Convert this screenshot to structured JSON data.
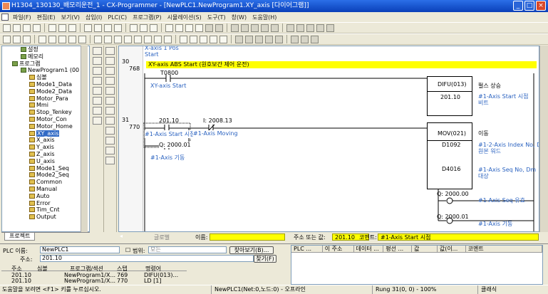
{
  "window": {
    "title": "H1304_130130_배모리운전_1 - CX-Programmer - [NewPLC1.NewProgram1.XY_axis  [다이어그램]]",
    "minimize": "_",
    "maximize": "□",
    "close": "×"
  },
  "menu": [
    "파일(F)",
    "편집(E)",
    "보기(V)",
    "삽입(I)",
    "PLC(C)",
    "프로그램(P)",
    "시뮬레이션(S)",
    "도구(T)",
    "창(W)",
    "도움말(H)"
  ],
  "tree": {
    "items": [
      {
        "label": "설정",
        "level": 1,
        "icon": "settings-icon"
      },
      {
        "label": "메모리",
        "level": 1,
        "icon": "memory-icon"
      },
      {
        "label": "프로그램",
        "level": 0,
        "icon": "programs-icon"
      },
      {
        "label": "NewProgram1 (00",
        "level": 1,
        "icon": "program-icon"
      },
      {
        "label": "심볼",
        "level": 2,
        "icon": "symbols-icon"
      },
      {
        "label": "Mode1_Data",
        "level": 2,
        "icon": "section-icon"
      },
      {
        "label": "Mode2_Data",
        "level": 2,
        "icon": "section-icon"
      },
      {
        "label": "Motor_Para",
        "level": 2,
        "icon": "section-icon"
      },
      {
        "label": "Mmi",
        "level": 2,
        "icon": "section-icon"
      },
      {
        "label": "Stop_Tenkey",
        "level": 2,
        "icon": "section-icon"
      },
      {
        "label": "Motor_Con",
        "level": 2,
        "icon": "section-icon"
      },
      {
        "label": "Motor_Home",
        "level": 2,
        "icon": "section-icon"
      },
      {
        "label": "XY_axis",
        "level": 2,
        "icon": "section-icon",
        "selected": true
      },
      {
        "label": "X_axis",
        "level": 2,
        "icon": "section-icon"
      },
      {
        "label": "Y_axis",
        "level": 2,
        "icon": "section-icon"
      },
      {
        "label": "Z_axis",
        "level": 2,
        "icon": "section-icon"
      },
      {
        "label": "U_axis",
        "level": 2,
        "icon": "section-icon"
      },
      {
        "label": "Mode1_Seq",
        "level": 2,
        "icon": "section-icon"
      },
      {
        "label": "Mode2_Seq",
        "level": 2,
        "icon": "section-icon"
      },
      {
        "label": "Common",
        "level": 2,
        "icon": "section-icon"
      },
      {
        "label": "Manual",
        "level": 2,
        "icon": "section-icon"
      },
      {
        "label": "Auto",
        "level": 2,
        "icon": "section-icon"
      },
      {
        "label": "Error",
        "level": 2,
        "icon": "section-icon"
      },
      {
        "label": "Tim_Cnt",
        "level": 2,
        "icon": "section-icon"
      },
      {
        "label": "Output",
        "level": 2,
        "icon": "section-icon"
      }
    ],
    "tab_label": "프로젝트"
  },
  "ladder": {
    "prev_comment": "X-axis 1 Pos\nStart",
    "rung30": {
      "num": "30",
      "step": "768",
      "comment": "XY-axis ABS Start (원호보간 제어 운전)",
      "contact_addr": "T0800",
      "contact_comment": "XY-axis Start",
      "instr": "DIFU(013)",
      "operand": "201.10",
      "operand_comment": "#1-Axis Start 시점\n비트",
      "instr_comment": "펄스 상승"
    },
    "rung31": {
      "num": "31",
      "step": "770",
      "contact1_addr": "201.10",
      "contact1_comment": "#1-Axis Start 시점",
      "contact2_addr": "I: 2008.13",
      "contact2_comment": "#1-Axis Moving",
      "contact3_addr": "Q: 2000.01",
      "contact3_comment": "#1-Axis 기동",
      "mov_instr": "MOV(021)",
      "mov_comment": "이동",
      "mov_src": "D1092",
      "mov_src_comment": "#1-2-Axis Index No, Dm\n원본 워드",
      "mov_dst": "D4016",
      "mov_dst_comment": "#1-Axis Seq No, Dm\n대상",
      "coil1_addr": "Q: 2000.00",
      "coil1_comment": "#1-Axis Seq 유효",
      "coil2_addr": "Q: 2000.01",
      "coil2_comment": "#1-Axis 기동"
    }
  },
  "infobar": {
    "tab": "글로벌",
    "name_label": "이름:",
    "name_value": "",
    "addr_label": "주소 또는 값:",
    "addr_value": "201.10",
    "comment_label": "코멘트:",
    "comment_value": "#1-Axis Start 시점"
  },
  "find": {
    "plc_label": "PLC 이름:",
    "plc_value": "NewPLC1",
    "scope_label": "범위:",
    "scope_value": "모든",
    "find_button": "찾아보기(B)...",
    "addr_label": "주소:",
    "addr_value": "201.10",
    "search_button": "찾기(F)",
    "columns": [
      "주소",
      "심볼",
      "프로그램/섹션",
      "스텝",
      "명령어"
    ],
    "rows": [
      [
        "201.10",
        "",
        "NewProgram1/X...",
        "769",
        "DIFU(013)..."
      ],
      [
        "201.10",
        "",
        "NewProgram1/X...",
        "770",
        "LD [1]"
      ]
    ]
  },
  "watch": {
    "columns": [
      "PLC ...",
      "이 주소",
      "데이터 ...",
      "평선 ...",
      "값",
      "값(이...",
      "코멘트"
    ]
  },
  "status": {
    "help": "도움말을 보려면 <F1> 키를 누르십시오.",
    "plc": "NewPLC1(Net:0,노드:0) - 오프라인",
    "rung": "Rung 31(0, 0)  - 100%",
    "mode": "클래식"
  }
}
